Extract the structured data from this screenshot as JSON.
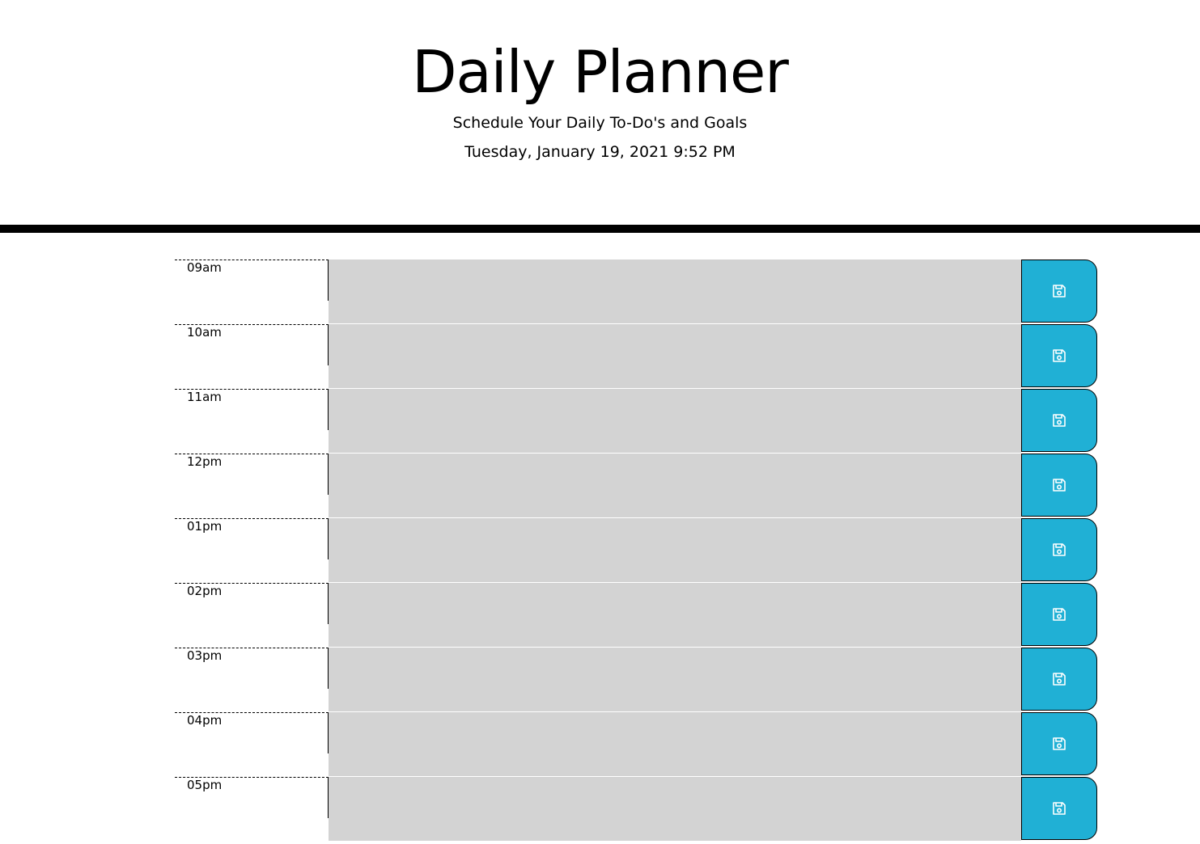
{
  "header": {
    "title": "Daily Planner",
    "lead": "Schedule Your Daily To-Do's and Goals",
    "current_day": "Tuesday, January 19, 2021 9:52 PM"
  },
  "colors": {
    "past_row": "#d3d3d3",
    "save_button": "#20b0d5"
  },
  "time_blocks": [
    {
      "hour": "09am",
      "description": ""
    },
    {
      "hour": "10am",
      "description": ""
    },
    {
      "hour": "11am",
      "description": ""
    },
    {
      "hour": "12pm",
      "description": ""
    },
    {
      "hour": "01pm",
      "description": ""
    },
    {
      "hour": "02pm",
      "description": ""
    },
    {
      "hour": "03pm",
      "description": ""
    },
    {
      "hour": "04pm",
      "description": ""
    },
    {
      "hour": "05pm",
      "description": ""
    }
  ],
  "icons": {
    "save": "save-icon"
  }
}
